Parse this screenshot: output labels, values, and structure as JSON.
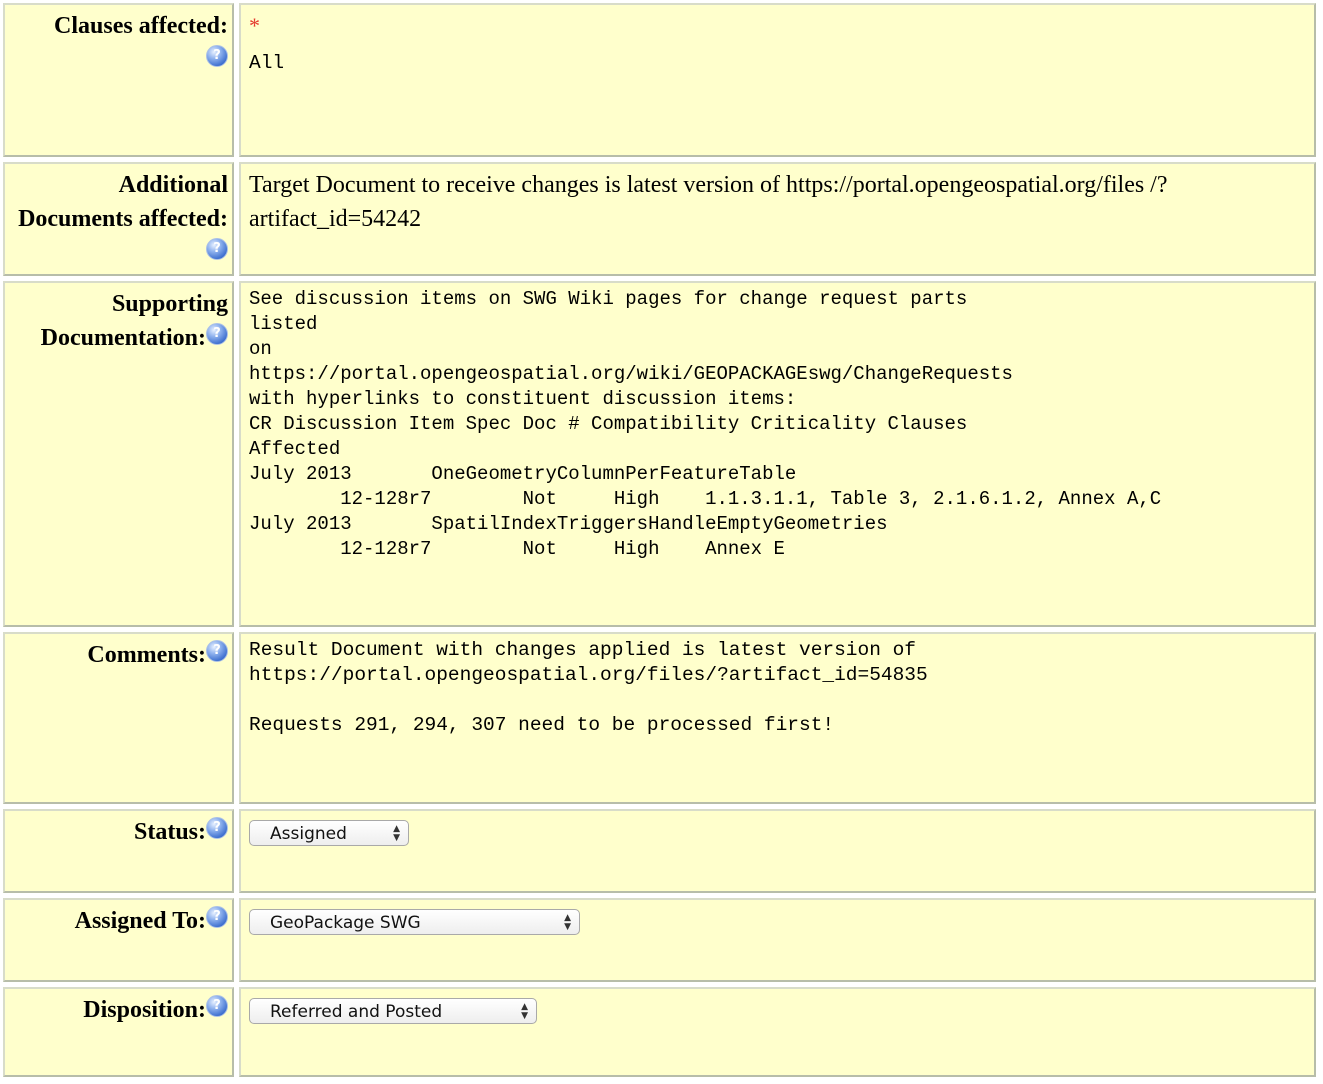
{
  "help_icon_glyph": "?",
  "colors": {
    "cell_background": "#ffffcc",
    "required_marker": "#e43b2f",
    "help_icon": "#3d6fcf"
  },
  "clauses_affected": {
    "label": "Clauses affected:",
    "required_marker": "*",
    "value": "All"
  },
  "additional_documents": {
    "label": "Additional Documents affected:",
    "value": "Target Document to receive changes is latest version of https://portal.opengeospatial.org/files /?artifact_id=54242"
  },
  "supporting_documentation": {
    "label": "Supporting Documentation:",
    "value": "See discussion items on SWG Wiki pages for change request parts\nlisted\non\nhttps://portal.opengeospatial.org/wiki/GEOPACKAGEswg/ChangeRequests\nwith hyperlinks to constituent discussion items:\nCR Discussion Item Spec Doc # Compatibility Criticality Clauses\nAffected\nJuly 2013       OneGeometryColumnPerFeatureTable\n        12-128r7        Not     High    1.1.3.1.1, Table 3, 2.1.6.1.2, Annex A,C\nJuly 2013       SpatilIndexTriggersHandleEmptyGeometries\n        12-128r7        Not     High    Annex E"
  },
  "comments": {
    "label": "Comments:",
    "value": "Result Document with changes applied is latest version of\nhttps://portal.opengeospatial.org/files/?artifact_id=54835\n\nRequests 291, 294, 307 need to be processed first!"
  },
  "status": {
    "label": "Status:",
    "selected": "Assigned"
  },
  "assigned_to": {
    "label": "Assigned To:",
    "selected": "GeoPackage SWG"
  },
  "disposition": {
    "label": "Disposition:",
    "selected": "Referred and Posted"
  }
}
